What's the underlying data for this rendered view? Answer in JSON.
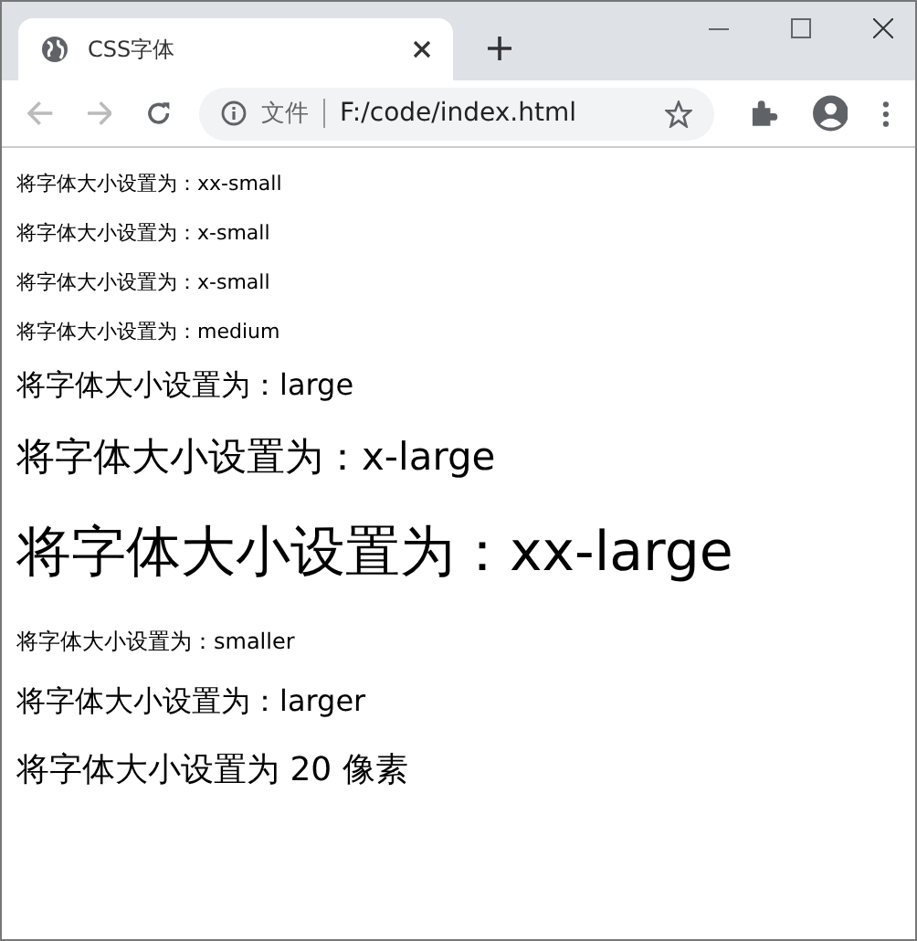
{
  "tab": {
    "title": "CSS字体",
    "selected": true
  },
  "address": {
    "scheme": "文件",
    "url": "F:/code/index.html"
  },
  "lines": [
    {
      "text": "将字体大小设置为：xx-small",
      "kind": "tiny"
    },
    {
      "text": "将字体大小设置为：x-small",
      "kind": "tiny"
    },
    {
      "text": "将字体大小设置为：x-small",
      "kind": "tiny"
    },
    {
      "text": "将字体大小设置为：medium",
      "kind": "tiny"
    },
    {
      "text": "将字体大小设置为：large",
      "kind": "large"
    },
    {
      "text": "将字体大小设置为：x-large",
      "kind": "xlarge"
    },
    {
      "text": "将字体大小设置为：xx-large",
      "kind": "xxlarge"
    },
    {
      "text": "将字体大小设置为：smaller",
      "kind": "small"
    },
    {
      "text": "将字体大小设置为：larger",
      "kind": "large"
    },
    {
      "text": "将字体大小设置为 20 像素",
      "kind": "px20"
    }
  ]
}
